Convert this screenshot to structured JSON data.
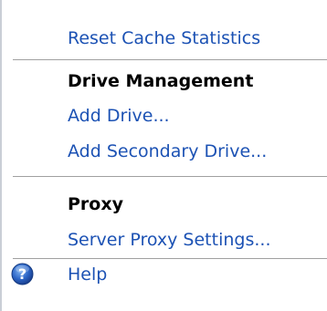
{
  "actions": {
    "reset_cache": "Reset Cache Statistics",
    "drive_management": {
      "heading": "Drive Management",
      "add_drive": "Add Drive...",
      "add_secondary_drive": "Add Secondary Drive..."
    },
    "proxy": {
      "heading": "Proxy",
      "server_proxy_settings": "Server Proxy Settings..."
    },
    "help": {
      "label": "Help",
      "icon": "help-icon"
    }
  },
  "colors": {
    "link": "#1c52b4",
    "heading": "#000000",
    "divider": "#a0a0a0",
    "help_icon": "#2b5fb8"
  }
}
